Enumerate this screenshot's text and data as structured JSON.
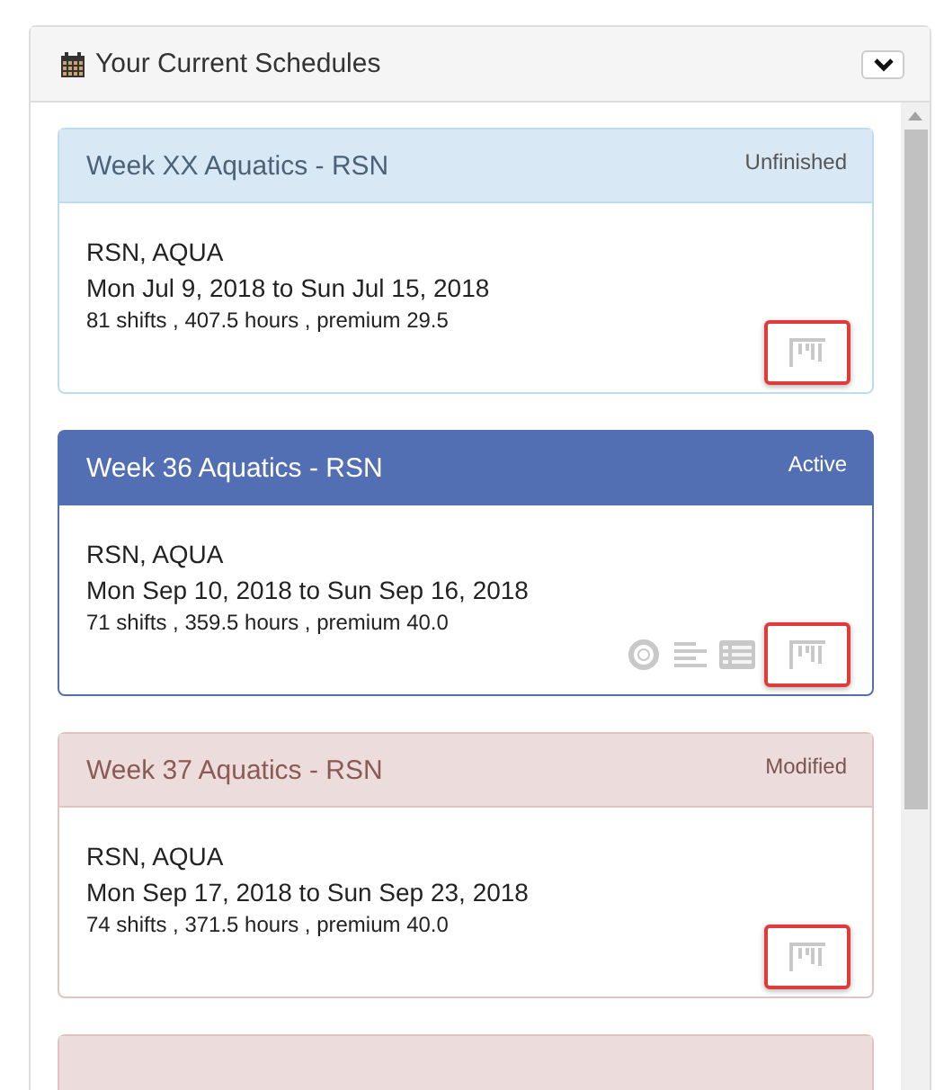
{
  "panel": {
    "title": "Your Current Schedules"
  },
  "cards": [
    {
      "kind": "unfinished",
      "title": "Week XX Aquatics - RSN",
      "status": "Unfinished",
      "units": "RSN, AQUA",
      "dates": "Mon Jul 9, 2018 to Sun Jul 15, 2018",
      "summary": "81 shifts , 407.5 hours , premium 29.5",
      "icons": [
        {
          "kind": "gantt",
          "highlighted": true
        }
      ]
    },
    {
      "kind": "active",
      "title": "Week 36 Aquatics - RSN",
      "status": "Active",
      "units": "RSN, AQUA",
      "dates": "Mon Sep 10, 2018 to Sun Sep 16, 2018",
      "summary": "71 shifts , 359.5 hours , premium 40.0",
      "icons": [
        {
          "kind": "lifebuoy",
          "highlighted": false
        },
        {
          "kind": "lines",
          "highlighted": false
        },
        {
          "kind": "list",
          "highlighted": false
        },
        {
          "kind": "gantt",
          "highlighted": true
        }
      ]
    },
    {
      "kind": "modified",
      "title": "Week 37 Aquatics - RSN",
      "status": "Modified",
      "units": "RSN, AQUA",
      "dates": "Mon Sep 17, 2018 to Sun Sep 23, 2018",
      "summary": "74 shifts , 371.5 hours , premium 40.0",
      "icons": [
        {
          "kind": "gantt",
          "highlighted": true
        }
      ]
    },
    {
      "kind": "modified"
    }
  ]
}
